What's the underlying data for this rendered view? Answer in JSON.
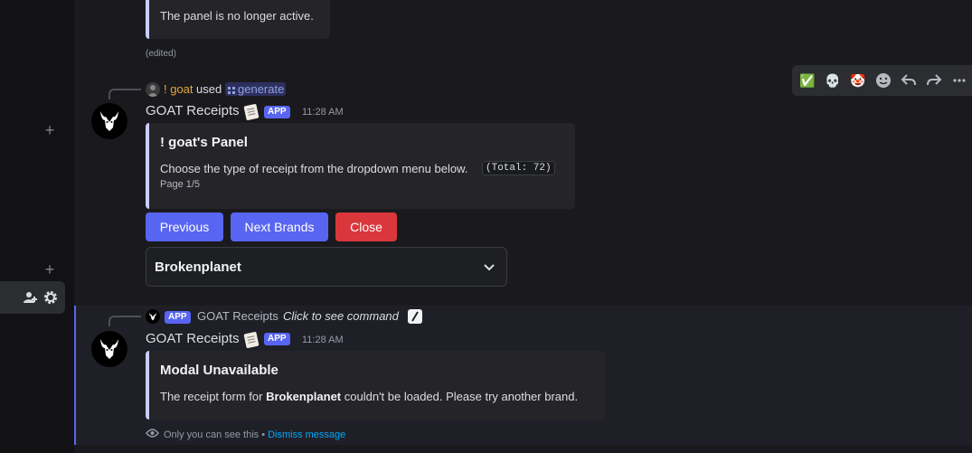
{
  "top_embed": {
    "description": "The panel is no longer active."
  },
  "edited_label": "(edited)",
  "message1": {
    "reply": {
      "user": "! goat",
      "used": "used",
      "command": "generate"
    },
    "author": "GOAT Receipts",
    "app_tag": "APP",
    "timestamp": "11:28 AM",
    "embed": {
      "title": "! goat's Panel",
      "description": "Choose the type of receipt from the dropdown menu below.",
      "code": "(Total: 72)",
      "footer": "Page 1/5"
    },
    "buttons": {
      "previous": "Previous",
      "next": "Next Brands",
      "close": "Close"
    },
    "select": {
      "value": "Brokenplanet"
    }
  },
  "message2": {
    "reply": {
      "app_tag": "APP",
      "author": "GOAT Receipts",
      "hint": "Click to see command"
    },
    "author": "GOAT Receipts",
    "app_tag": "APP",
    "timestamp": "11:28 AM",
    "embed": {
      "title": "Modal Unavailable",
      "desc_before": "The receipt form for",
      "desc_bold": "Brokenplanet",
      "desc_after": "couldn't be loaded. Please try another brand."
    },
    "ephemeral": {
      "note": "Only you can see this •",
      "dismiss": "Dismiss message"
    }
  },
  "reactions": [
    "✅",
    "💀",
    "🤡"
  ],
  "colors": {
    "blurple": "#5865f2",
    "danger": "#da373c",
    "embed_border": "#c9cdfb",
    "background": "#1a1a1e"
  }
}
